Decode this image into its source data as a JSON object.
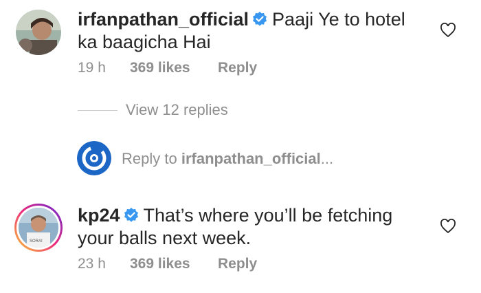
{
  "comments": [
    {
      "username": "irfanpathan_official",
      "text": "Paaji Ye to hotel ka baagicha Hai",
      "time": "19 h",
      "likes": "369 likes",
      "reply_label": "Reply",
      "view_replies": "View 12 replies"
    },
    {
      "username": "kp24",
      "text": "That’s where you’ll be fetching your balls next week.",
      "time": "23 h",
      "likes": "369 likes",
      "reply_label": "Reply"
    }
  ],
  "reply_box": {
    "prefix": "Reply to ",
    "target": "irfanpathan_official",
    "ellipsis": "..."
  },
  "icons": {
    "verified": "verified-badge-icon",
    "heart": "heart-outline-icon"
  },
  "colors": {
    "verified": "#3897f0",
    "muted": "#8e8e8e",
    "text": "#262626"
  }
}
